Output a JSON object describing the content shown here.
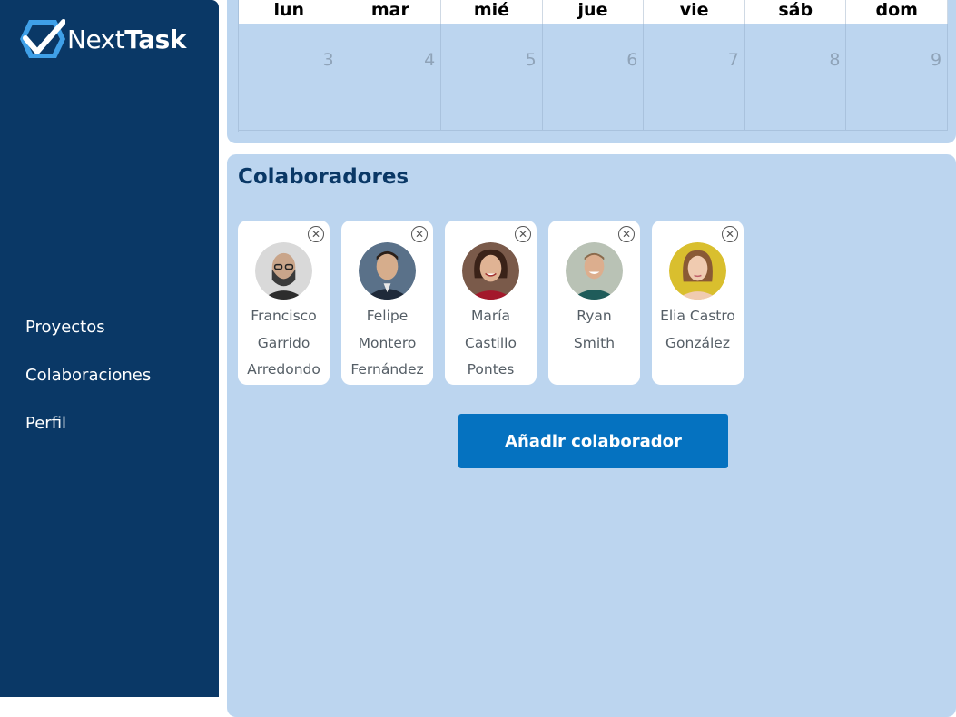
{
  "brand": {
    "part1": "Next",
    "part2": "Task"
  },
  "nav": {
    "items": [
      {
        "label": "Proyectos"
      },
      {
        "label": "Colaboraciones"
      },
      {
        "label": "Perfil"
      }
    ]
  },
  "calendar": {
    "weekdays": [
      "lun",
      "mar",
      "mié",
      "jue",
      "vie",
      "sáb",
      "dom"
    ],
    "week_days": [
      "3",
      "4",
      "5",
      "6",
      "7",
      "8",
      "9"
    ]
  },
  "collaborators": {
    "title": "Colaboradores",
    "people": [
      {
        "name": "Francisco Garrido Arredondo",
        "lines": [
          "Francisco",
          "Garrido",
          "Arredondo"
        ]
      },
      {
        "name": "Felipe Montero Fernández",
        "lines": [
          "Felipe",
          "Montero",
          "Fernández"
        ]
      },
      {
        "name": "María Castillo Pontes",
        "lines": [
          "María",
          "Castillo",
          "Pontes"
        ]
      },
      {
        "name": "Ryan Smith",
        "lines": [
          "Ryan",
          "Smith"
        ]
      },
      {
        "name": "Elia Castro González",
        "lines": [
          "Elia Castro",
          "González"
        ]
      }
    ],
    "remove_glyph": "✕",
    "add_button": "Añadir colaborador"
  },
  "colors": {
    "sidebar": "#0a3866",
    "panel": "#bcd5ef",
    "accent": "#0572c0",
    "title": "#0a3866"
  }
}
